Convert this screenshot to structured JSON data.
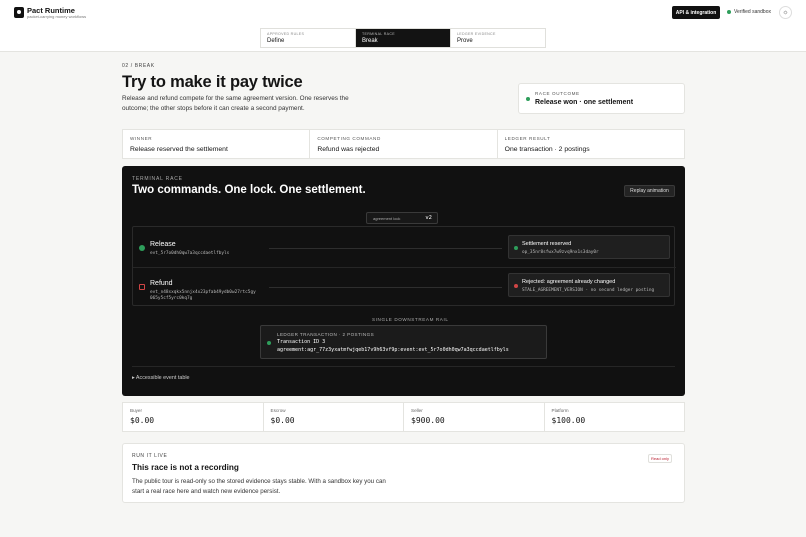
{
  "header": {
    "brand": "Pact Runtime",
    "tagline": "packet-carrying money workflows",
    "api_label": "API & integration",
    "verified_label": "Verified sandbox",
    "theme_icon": "sun-icon"
  },
  "steps": [
    {
      "kicker": "APPROVED RULES",
      "value": "Define",
      "active": false
    },
    {
      "kicker": "TERMINAL RACE",
      "value": "Break",
      "active": true
    },
    {
      "kicker": "LEDGER EVIDENCE",
      "value": "Prove",
      "active": false
    }
  ],
  "intro": {
    "eyebrow": "02 / BREAK",
    "title": "Try to make it pay twice",
    "lead": "Release and refund compete for the same agreement version. One reserves the outcome; the other stops before it can create a second payment."
  },
  "outcome": {
    "kicker": "RACE OUTCOME",
    "value": "Release won · one settlement"
  },
  "facts": [
    {
      "kicker": "WINNER",
      "value": "Release reserved the settlement"
    },
    {
      "kicker": "COMPETING COMMAND",
      "value": "Refund was rejected"
    },
    {
      "kicker": "LEDGER RESULT",
      "value": "One transaction · 2 postings"
    }
  ],
  "race": {
    "kicker": "TERMINAL RACE",
    "title": "Two commands. One lock. One settlement.",
    "replay_label": "Replay animation",
    "lock_label": "agreement lock",
    "lock_version": "v2",
    "lanes": [
      {
        "title": "Release",
        "id": "evt_5r7o0dh0qw7a3qccdaetlfbyls",
        "status_color": "#2e9e5b",
        "result_title": "Settlement reserved",
        "result_meta": "op_35nr8sfwx7w9zvq9nx1s3day0r"
      },
      {
        "title": "Refund",
        "id": "evt_n48sxqkx5nnjx4x23pfab49ydb0w27rtc5gy 065y5cf5yrc0kq7g",
        "status_color": "#d04545",
        "result_title": "Rejected: agreement already changed",
        "result_meta": "STALE_AGREEMENT_VERSION · no second ledger posting"
      }
    ],
    "rail_label": "SINGLE DOWNSTREAM RAIL",
    "ledger": {
      "kicker": "LEDGER TRANSACTION · 2 POSTINGS",
      "line1": "Transaction ID 3",
      "line2": "agreement:agr_77z3yxatmfwjqeb17v9h63vf9p:event:evt_5r7o0dh0qw7a3qccdaetlfbyls"
    },
    "accessible_label": "▸ Accessible event table"
  },
  "balances": [
    {
      "label": "Buyer",
      "value": "$0.00"
    },
    {
      "label": "Escrow",
      "value": "$0.00"
    },
    {
      "label": "Seller",
      "value": "$900.00"
    },
    {
      "label": "Platform",
      "value": "$100.00"
    }
  ],
  "live": {
    "kicker": "RUN IT LIVE",
    "title": "This race is not a recording",
    "body": "The public tour is read-only so the stored evidence stays stable. With a sandbox key you can start a real race here and watch new evidence persist.",
    "badge": "Read only"
  },
  "colors": {
    "success": "#2e9e5b",
    "danger": "#d04545",
    "dark": "#111111"
  }
}
